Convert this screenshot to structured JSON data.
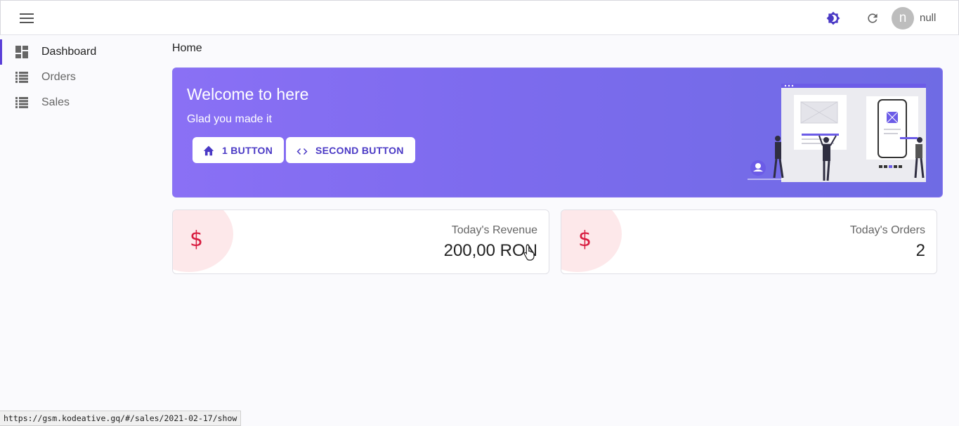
{
  "header": {
    "menu_icon": "hamburger-icon",
    "theme_icon": "brightness-icon",
    "refresh_icon": "refresh-icon",
    "avatar_initial": "n",
    "username": "null",
    "accent": "#5a3fd8"
  },
  "sidebar": {
    "items": [
      {
        "label": "Dashboard",
        "icon": "dashboard-icon",
        "active": true
      },
      {
        "label": "Orders",
        "icon": "list-icon",
        "active": false
      },
      {
        "label": "Sales",
        "icon": "list-icon",
        "active": false
      }
    ]
  },
  "breadcrumb": "Home",
  "welcome": {
    "title": "Welcome to here",
    "subtitle": "Glad you made it",
    "buttons": [
      {
        "label": "1 BUTTON",
        "icon": "home-icon"
      },
      {
        "label": "SECOND BUTTON",
        "icon": "code-icon"
      }
    ],
    "gradient": [
      "#8a70f5",
      "#6f6be4"
    ]
  },
  "cards": [
    {
      "label": "Today's Revenue",
      "value": "200,00 RON",
      "icon": "dollar-icon",
      "symbol": "$"
    },
    {
      "label": "Today's Orders",
      "value": "2",
      "icon": "dollar-icon",
      "symbol": "$"
    }
  ],
  "status_url": "https://gsm.kodeative.gq/#/sales/2021-02-17/show"
}
